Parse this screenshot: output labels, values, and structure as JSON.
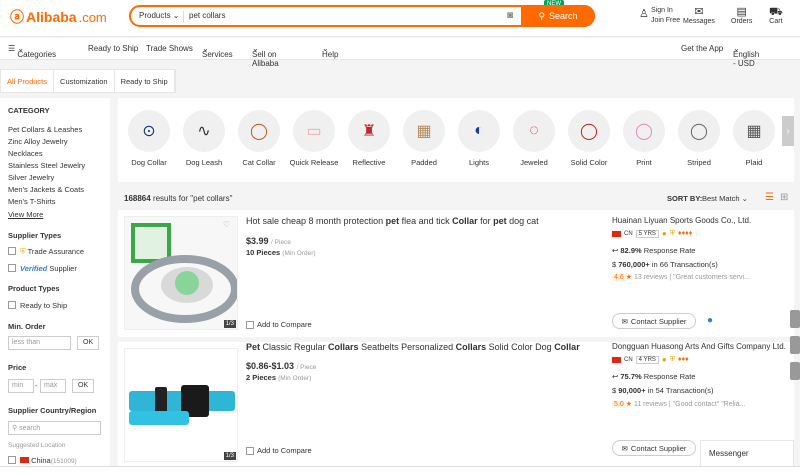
{
  "header": {
    "logo": "Alibaba",
    "logo_domain": ".com",
    "search_category": "Products",
    "search_query": "pet collars",
    "search_button": "Search",
    "new_badge": "NEW",
    "sign_in": "Sign In",
    "join_free": "Join Free",
    "messages": "Messages",
    "orders": "Orders",
    "cart": "Cart",
    "accent": "#ff6a00"
  },
  "nav": {
    "categories": "Categories",
    "items": [
      "Ready to Ship",
      "Trade Shows",
      "Services",
      "Sell on Alibaba",
      "Help"
    ],
    "get_app": "Get the App",
    "lang": "English - USD"
  },
  "tabs": [
    "All Products",
    "Customization",
    "Ready to Ship"
  ],
  "sidebar": {
    "category_title": "CATEGORY",
    "categories": [
      "Pet Collars & Leashes",
      "Zinc Alloy Jewelry",
      "Necklaces",
      "Stainless Steel Jewelry",
      "Silver Jewelry",
      "Men's Jackets & Coats",
      "Men's T-Shirts"
    ],
    "view_more": "View More",
    "supplier_types": "Supplier Types",
    "trade_assurance": "Trade Assurance",
    "verified": "Verified",
    "supplier": "Supplier",
    "product_types": "Product Types",
    "ready_to_ship": "Ready to Ship",
    "min_order": "Min. Order",
    "less_than": "less than",
    "ok": "OK",
    "price": "Price",
    "min": "min",
    "max": "max",
    "dash": "-",
    "country_region": "Supplier Country/Region",
    "search_placeholder": "search",
    "suggested": "Suggested Location",
    "china": "China",
    "china_count": "(151009)"
  },
  "catbar": [
    {
      "label": "Dog Collar",
      "icon": "collar-icon"
    },
    {
      "label": "Dog Leash",
      "icon": "leash-icon"
    },
    {
      "label": "Cat Collar",
      "icon": "collar-icon"
    },
    {
      "label": "Quick Release",
      "icon": "buckle-icon"
    },
    {
      "label": "Reflective",
      "icon": "harness-icon"
    },
    {
      "label": "Padded",
      "icon": "plaid-icon"
    },
    {
      "label": "Lights",
      "icon": "light-icon"
    },
    {
      "label": "Jeweled",
      "icon": "jewel-icon"
    },
    {
      "label": "Solid Color",
      "icon": "collar-icon"
    },
    {
      "label": "Print",
      "icon": "print-icon"
    },
    {
      "label": "Striped",
      "icon": "stripe-icon"
    },
    {
      "label": "Plaid",
      "icon": "plaid-icon"
    }
  ],
  "results": {
    "count": "168864",
    "text": "results for \"pet collars\"",
    "sort_by": "SORT BY:",
    "sort_value": "Best Match"
  },
  "products": [
    {
      "title_parts": [
        [
          "Hot sale cheap 8 month protection ",
          false
        ],
        [
          "pet",
          true
        ],
        [
          " flea and tick ",
          false
        ],
        [
          "Collar",
          true
        ],
        [
          " for ",
          false
        ],
        [
          "pet",
          true
        ],
        [
          " dog cat",
          false
        ]
      ],
      "price": "$3.99",
      "price_unit": "/ Piece",
      "moq": "10 Pieces",
      "moq_note": "(Min Order)",
      "compare": "Add to Compare",
      "pager": "1/3",
      "supplier": "Huainan Liyuan Sports Goods Co., Ltd.",
      "country": "CN",
      "years": "5 YRS",
      "response_rate": "82.9%",
      "response_label": "Response Rate",
      "transactions": "760,000+",
      "transactions_detail": "in 66 Transaction(s)",
      "score": "4.6",
      "reviews": "13 reviews",
      "review_quote": "\"Great customers servi...",
      "contact": "Contact Supplier"
    },
    {
      "title_parts": [
        [
          "Pet",
          true
        ],
        [
          " Classic Regular ",
          false
        ],
        [
          "Collars",
          true
        ],
        [
          " Seatbelts Personalized ",
          false
        ],
        [
          "Collars",
          true
        ],
        [
          " Solid Color Dog ",
          false
        ],
        [
          "Collar",
          true
        ]
      ],
      "price": "$0.86-$1.03",
      "price_unit": "/ Piece",
      "moq": "2 Pieces",
      "moq_note": "(Min Order)",
      "compare": "Add to Compare",
      "pager": "1/3",
      "supplier": "Dongguan Huasong Arts And Gifts Company Ltd.",
      "country": "CN",
      "years": "4 YRS",
      "response_rate": "75.7%",
      "response_label": "Response Rate",
      "transactions": "90,000+",
      "transactions_detail": "in 54 Transaction(s)",
      "score": "5.0",
      "reviews": "11 reviews",
      "review_quote": "\"Good contact\"  \"Relia...",
      "contact": "Contact Supplier"
    }
  ],
  "messenger": "Messenger"
}
